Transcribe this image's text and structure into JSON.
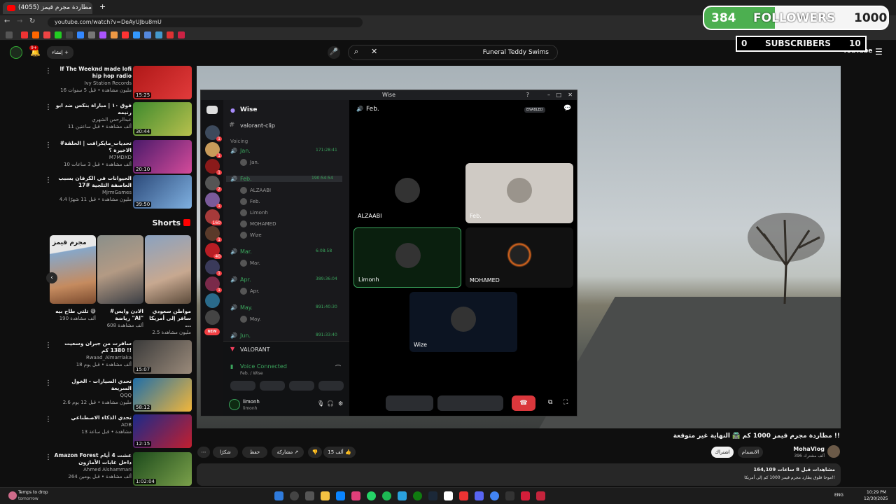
{
  "browser": {
    "tab_title": "(4055) مطاردة مجرم قيمز",
    "url": "youtube.com/watch?v=DeAyUJbu8mU",
    "new_tab": "+"
  },
  "overlay": {
    "followers_count": "384",
    "followers_label": "FOLLOWERS",
    "followers_goal": "1000",
    "followers_fraction": 0.384,
    "subscribers_count": "0",
    "subscribers_label": "SUBSCRIBERS",
    "subscribers_goal": "10"
  },
  "youtube": {
    "search_query": "Funeral Teddy Swims",
    "create_label": "إنشاء",
    "notif_count": "9+",
    "logo": "YouTube",
    "video_title": "مطاردة مجرم قيمز 1000 كم 🛣️ النهاية غير متوقعة !!",
    "channel_name": "MohaVlog",
    "channel_subs": "396 ألف مشترك",
    "join_label": "الانضمام",
    "subscribe_label": "اشتراك",
    "likes": "15 ألف",
    "share_label": "مشاركة",
    "save_label": "حفظ",
    "thanks_label": "شكرًا",
    "views_line": "164,109 مشاهدات  قبل 8 ساعات",
    "desc_line": "موحا فلوق يطارد مجرم قيمز 1000 كم إلى أمريكا!!",
    "shorts_label": "Shorts",
    "sidebar": [
      {
        "title": "If The Weeknd made lofi hip hop radio",
        "channel": "Ivy Station Records",
        "meta": "16 مليون مشاهدة • قبل 5 سنوات",
        "duration": "15:25"
      },
      {
        "title": "فوق ١٠ | مباراة بنكس ضد ابو رنيمه",
        "channel": "عبدالرحمن الشهري",
        "meta": "11 ألف مشاهدة • قبل ساعتين",
        "duration": "30:44"
      },
      {
        "title": "#تحديات_مايكرافت | الحلقة الاخيرة ؟",
        "channel": "M7MDXD",
        "meta": "10 ألف مشاهدة • قبل 3 ساعات",
        "duration": "20:10"
      },
      {
        "title": "الحيوانات في الكرفان بسبب العاصفة الثلجية #17",
        "channel": "MjrmGames",
        "meta": "4.4 مليون مشاهدة • قبل 11 شهرًا",
        "duration": "39:50"
      },
      {
        "title": "سافرت من جبران وسعيت 1380 كم !!",
        "channel": "Rwaad_Almarriaka",
        "meta": "18 ألف مشاهدة • قبل يوم",
        "duration": "15:07"
      },
      {
        "title": "تحدي السيارات - الخول السريعة",
        "channel": "QQQ",
        "meta": "2.6 مليون مشاهدة • قبل 12 يوم",
        "duration": "58:12"
      },
      {
        "title": "تحدي الذكاء الاصطناعي",
        "channel": "ADB",
        "meta": "13 مشاهدة • قبل ساعة",
        "duration": "12:15"
      },
      {
        "title": "Amazon Forest عشت 4 أيام داخل غابات الأمازون",
        "channel": "Ahmed Alshammari",
        "meta": "264 ألف مشاهدة • قبل يومين",
        "duration": "1:02:04"
      }
    ],
    "shorts": [
      {
        "title": "مواطن سعودي سافر إلى أمريكا ...",
        "meta": "2.5 مليون مشاهدة"
      },
      {
        "title": "#الادن وايس رياضة \"AI\"",
        "meta": "608 ألف مشاهدة"
      },
      {
        "title": "تلتي طاح بيه 😅",
        "meta": "190 ألف مشاهدة"
      }
    ],
    "short_caption": "مجرم قيمز"
  },
  "discord": {
    "window_title": "Wise",
    "server_name": "Wise",
    "text_channel": "valorant-clip",
    "voice_category": "Voicing",
    "channels": [
      {
        "name": "Jan.",
        "time": "171:28:41",
        "users": [
          "Jan."
        ]
      },
      {
        "name": "Feb.",
        "time": "190:54:54",
        "users": [
          "ALZAABI",
          "Feb.",
          "Limonh",
          "MOHAMED",
          "Wize"
        ]
      },
      {
        "name": "Mar.",
        "time": "6:08:58",
        "users": [
          "Mar."
        ]
      },
      {
        "name": "Apr.",
        "time": "389:36:04",
        "users": [
          "Apr."
        ]
      },
      {
        "name": "May.",
        "time": "891:40:30",
        "users": [
          "May."
        ]
      },
      {
        "name": "Jun.",
        "time": "891:33:40",
        "users": []
      }
    ],
    "limonh_tag": "limo",
    "wize_tag": "Wise",
    "new_badge": "NEW",
    "activity": "VALORANT",
    "voice_connected": "Voice Connected",
    "voice_location": "Feb. / Wise",
    "user_name": "limonh",
    "user_status": "limonh",
    "call_channel": "Feb.",
    "enabled_label": "ENABLED",
    "tiles": [
      {
        "name": "ALZAABI"
      },
      {
        "name": "Feb."
      },
      {
        "name": "Limonh"
      },
      {
        "name": "MOHAMED"
      },
      {
        "name": "Wize"
      }
    ],
    "guild_badges": [
      "1",
      "1",
      "1",
      "2",
      "1",
      "160",
      "1",
      "40",
      "1",
      "1"
    ]
  },
  "taskbar": {
    "weather_line1": "Temps to drop",
    "weather_line2": "tomorrow",
    "lang": "ENG",
    "time": "10:29 PM",
    "date": "12/30/2025"
  },
  "colors": {
    "accent_red": "#ff0000",
    "discord_green": "#3ba55d",
    "follower_green": "#4caf50",
    "hangup": "#da373c"
  }
}
